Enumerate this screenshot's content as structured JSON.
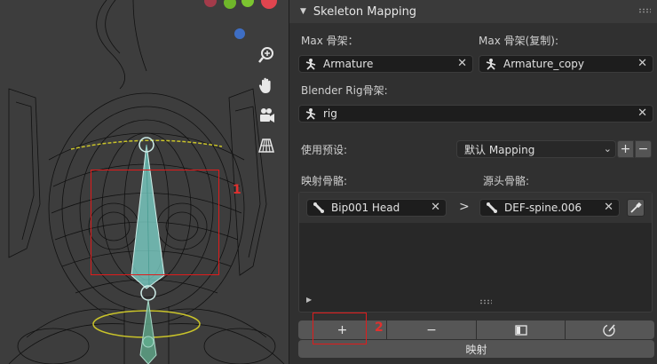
{
  "panel": {
    "title": "Skeleton Mapping",
    "max_armature_label": "Max 骨架：",
    "max_armature_value": "Armature",
    "max_copy_label": "Max 骨架(复制):",
    "max_copy_value": "Armature_copy",
    "blender_rig_label": "Blender Rig骨架:",
    "blender_rig_value": "rig",
    "preset_label": "使用预设:",
    "preset_value": "默认 Mapping",
    "map_bone_label": "映射骨骼:",
    "source_bone_label": "源头骨骼:",
    "mapping_rows": [
      {
        "target": "Bip001 Head",
        "arrow": ">",
        "source": "DEF-spine.006"
      }
    ],
    "add_symbol": "+",
    "remove_symbol": "−",
    "plus_small": "+",
    "minus_small": "−",
    "map_button": "映射"
  },
  "annotations": {
    "one": "1",
    "two": "2"
  },
  "viewport_tools": [
    "zoom-icon",
    "hand-pan-icon",
    "camera-icon",
    "grid-icon"
  ],
  "colors": {
    "annotation_red": "#e01b1b",
    "bone_cyan": "#7fd8cf",
    "panel_bg": "#303030",
    "field_bg": "#1d1d1d"
  }
}
